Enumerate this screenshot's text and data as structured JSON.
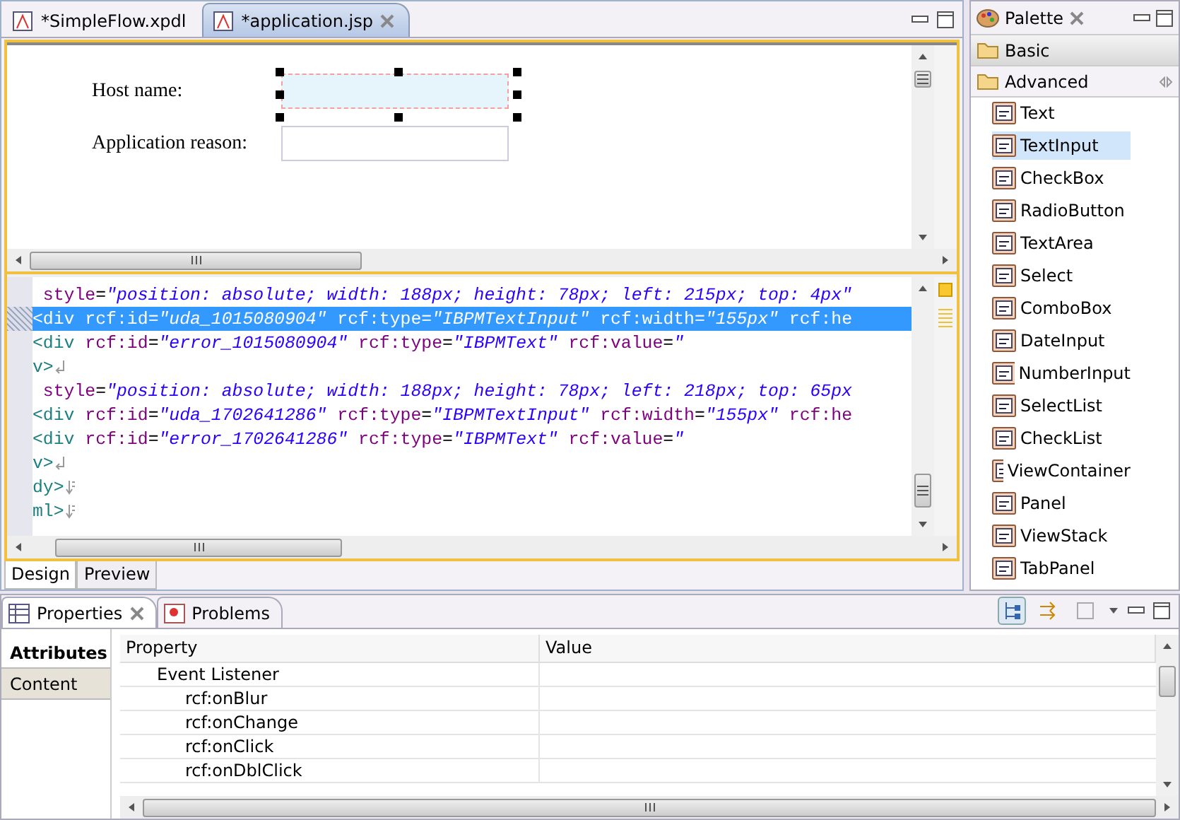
{
  "editor_tabs": [
    {
      "label": "*SimpleFlow.xpdl",
      "selected": false
    },
    {
      "label": "*application.jsp",
      "selected": true
    }
  ],
  "design_form": {
    "fields": [
      {
        "label": "Host name:",
        "selected": true
      },
      {
        "label": "Application reason:",
        "selected": false
      }
    ]
  },
  "source_lines": [
    {
      "selected": false,
      "tokens": [
        {
          "kind": "attr",
          "text": " style"
        },
        {
          "kind": "plain",
          "text": "="
        },
        {
          "kind": "str",
          "text": "\"position: absolute; width: 188px; height: 78px; left: 215px; top: 4px\""
        }
      ]
    },
    {
      "selected": true,
      "tokens": [
        {
          "kind": "tag",
          "text": "<div"
        },
        {
          "kind": "attr",
          "text": " rcf:id"
        },
        {
          "kind": "plain",
          "text": "="
        },
        {
          "kind": "str",
          "text": "\"uda_1015080904\""
        },
        {
          "kind": "attr",
          "text": " rcf:type"
        },
        {
          "kind": "plain",
          "text": "="
        },
        {
          "kind": "str",
          "text": "\"IBPMTextInput\""
        },
        {
          "kind": "attr",
          "text": " rcf:width"
        },
        {
          "kind": "plain",
          "text": "="
        },
        {
          "kind": "str",
          "text": "\"155px\""
        },
        {
          "kind": "attr",
          "text": " rcf:he"
        }
      ]
    },
    {
      "selected": false,
      "tokens": [
        {
          "kind": "tag",
          "text": "<div"
        },
        {
          "kind": "attr",
          "text": " rcf:id"
        },
        {
          "kind": "plain",
          "text": "="
        },
        {
          "kind": "str",
          "text": "\"error_1015080904\""
        },
        {
          "kind": "attr",
          "text": " rcf:type"
        },
        {
          "kind": "plain",
          "text": "="
        },
        {
          "kind": "str",
          "text": "\"IBPMText\""
        },
        {
          "kind": "attr",
          "text": " rcf:value"
        },
        {
          "kind": "plain",
          "text": "="
        },
        {
          "kind": "str",
          "text": "\""
        }
      ]
    },
    {
      "selected": false,
      "tokens": [
        {
          "kind": "tag",
          "text": "v>"
        },
        {
          "kind": "eol"
        }
      ]
    },
    {
      "selected": false,
      "tokens": [
        {
          "kind": "attr",
          "text": " style"
        },
        {
          "kind": "plain",
          "text": "="
        },
        {
          "kind": "str",
          "text": "\"position: absolute; width: 188px; height: 78px; left: 218px; top: 65px"
        }
      ]
    },
    {
      "selected": false,
      "tokens": [
        {
          "kind": "tag",
          "text": "<div"
        },
        {
          "kind": "attr",
          "text": " rcf:id"
        },
        {
          "kind": "plain",
          "text": "="
        },
        {
          "kind": "str",
          "text": "\"uda_1702641286\""
        },
        {
          "kind": "attr",
          "text": " rcf:type"
        },
        {
          "kind": "plain",
          "text": "="
        },
        {
          "kind": "str",
          "text": "\"IBPMTextInput\""
        },
        {
          "kind": "attr",
          "text": " rcf:width"
        },
        {
          "kind": "plain",
          "text": "="
        },
        {
          "kind": "str",
          "text": "\"155px\""
        },
        {
          "kind": "attr",
          "text": " rcf:he"
        }
      ]
    },
    {
      "selected": false,
      "tokens": [
        {
          "kind": "tag",
          "text": "<div"
        },
        {
          "kind": "attr",
          "text": " rcf:id"
        },
        {
          "kind": "plain",
          "text": "="
        },
        {
          "kind": "str",
          "text": "\"error_1702641286\""
        },
        {
          "kind": "attr",
          "text": " rcf:type"
        },
        {
          "kind": "plain",
          "text": "="
        },
        {
          "kind": "str",
          "text": "\"IBPMText\""
        },
        {
          "kind": "attr",
          "text": " rcf:value"
        },
        {
          "kind": "plain",
          "text": "="
        },
        {
          "kind": "str",
          "text": "\""
        }
      ]
    },
    {
      "selected": false,
      "tokens": [
        {
          "kind": "tag",
          "text": "v>"
        },
        {
          "kind": "eol"
        }
      ]
    },
    {
      "selected": false,
      "tokens": [
        {
          "kind": "tag",
          "text": "dy>"
        },
        {
          "kind": "eof"
        }
      ]
    },
    {
      "selected": false,
      "tokens": [
        {
          "kind": "tag",
          "text": "ml>"
        },
        {
          "kind": "eof"
        }
      ]
    }
  ],
  "view_tabs": [
    {
      "label": "Design",
      "selected": true
    },
    {
      "label": "Preview",
      "selected": false
    }
  ],
  "palette": {
    "title": "Palette",
    "drawers": [
      {
        "label": "Basic",
        "expanded": false
      },
      {
        "label": "Advanced",
        "expanded": true,
        "items": [
          {
            "label": "Text",
            "selected": false
          },
          {
            "label": "TextInput",
            "selected": true
          },
          {
            "label": "CheckBox",
            "selected": false
          },
          {
            "label": "RadioButton",
            "selected": false
          },
          {
            "label": "TextArea",
            "selected": false
          },
          {
            "label": "Select",
            "selected": false
          },
          {
            "label": "ComboBox",
            "selected": false
          },
          {
            "label": "DateInput",
            "selected": false
          },
          {
            "label": "NumberInput",
            "selected": false
          },
          {
            "label": "SelectList",
            "selected": false
          },
          {
            "label": "CheckList",
            "selected": false
          },
          {
            "label": "ViewContainer",
            "selected": false
          },
          {
            "label": "Panel",
            "selected": false
          },
          {
            "label": "ViewStack",
            "selected": false
          },
          {
            "label": "TabPanel",
            "selected": false
          }
        ]
      }
    ]
  },
  "bottom_tabs": [
    {
      "label": "Properties",
      "selected": true
    },
    {
      "label": "Problems",
      "selected": false
    }
  ],
  "property_sections": [
    {
      "label": "Attributes",
      "selected": true
    },
    {
      "label": "Content",
      "selected": false
    }
  ],
  "table": {
    "columns": [
      "Property",
      "Value"
    ],
    "rows": [
      {
        "property": "Event Listener",
        "children": [
          {
            "property": "rcf:onBlur"
          },
          {
            "property": "rcf:onChange"
          },
          {
            "property": "rcf:onClick"
          },
          {
            "property": "rcf:onDblClick"
          }
        ]
      }
    ]
  }
}
